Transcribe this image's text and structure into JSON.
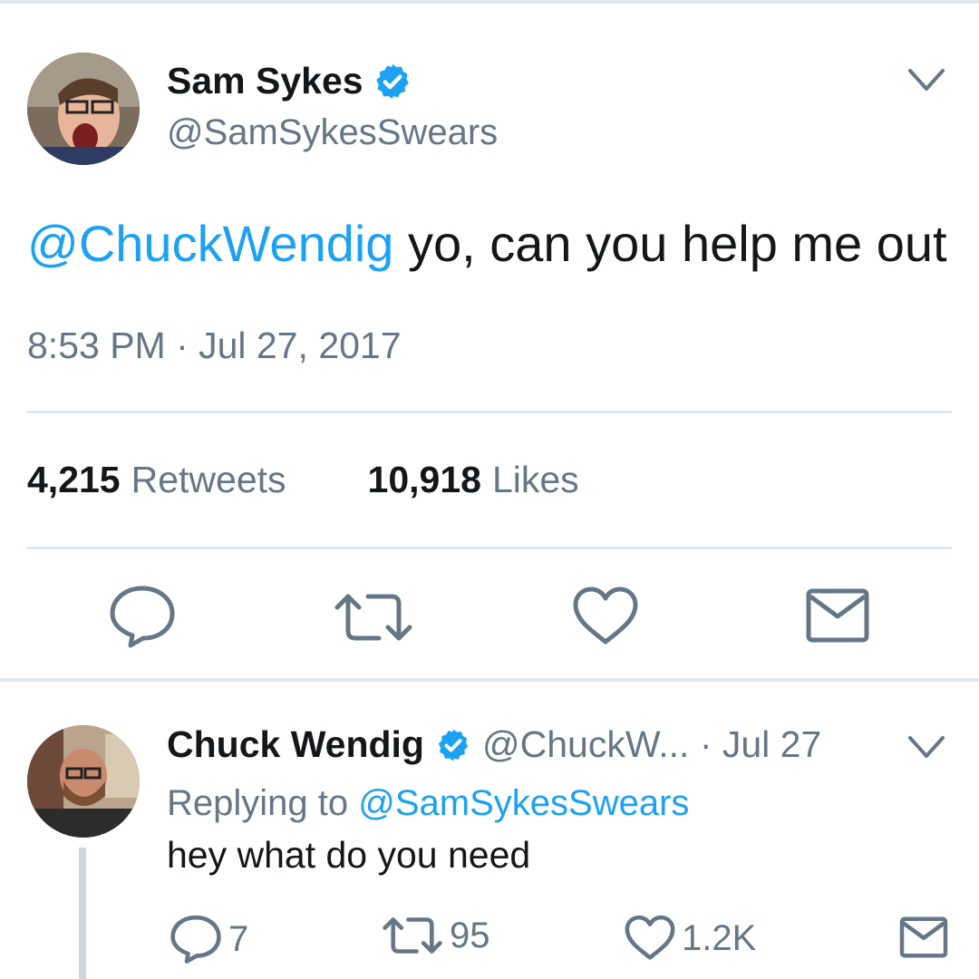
{
  "main_tweet": {
    "author_name": "Sam Sykes",
    "author_handle": "@SamSykesSwears",
    "mention": "@ChuckWendig",
    "text": " yo, can you help me out",
    "timestamp": "8:53 PM · Jul 27, 2017",
    "retweets_count": "4,215",
    "retweets_label": "Retweets",
    "likes_count": "10,918",
    "likes_label": "Likes"
  },
  "reply_tweet": {
    "author_name": "Chuck Wendig",
    "author_handle_date": "@ChuckW... · Jul 27",
    "replying_to_label": "Replying to ",
    "replying_to_handle": "@SamSykesSwears",
    "text": "hey what do you need",
    "reply_count": "7",
    "retweet_count": "95",
    "like_count": "1.2K"
  },
  "colors": {
    "accent": "#1da1f2",
    "secondary_text": "#657786",
    "icon": "#657786",
    "divider": "#e1e8ed"
  },
  "icons": [
    "verified-badge-icon",
    "chevron-down-icon",
    "reply-icon",
    "retweet-icon",
    "like-icon",
    "message-icon"
  ]
}
